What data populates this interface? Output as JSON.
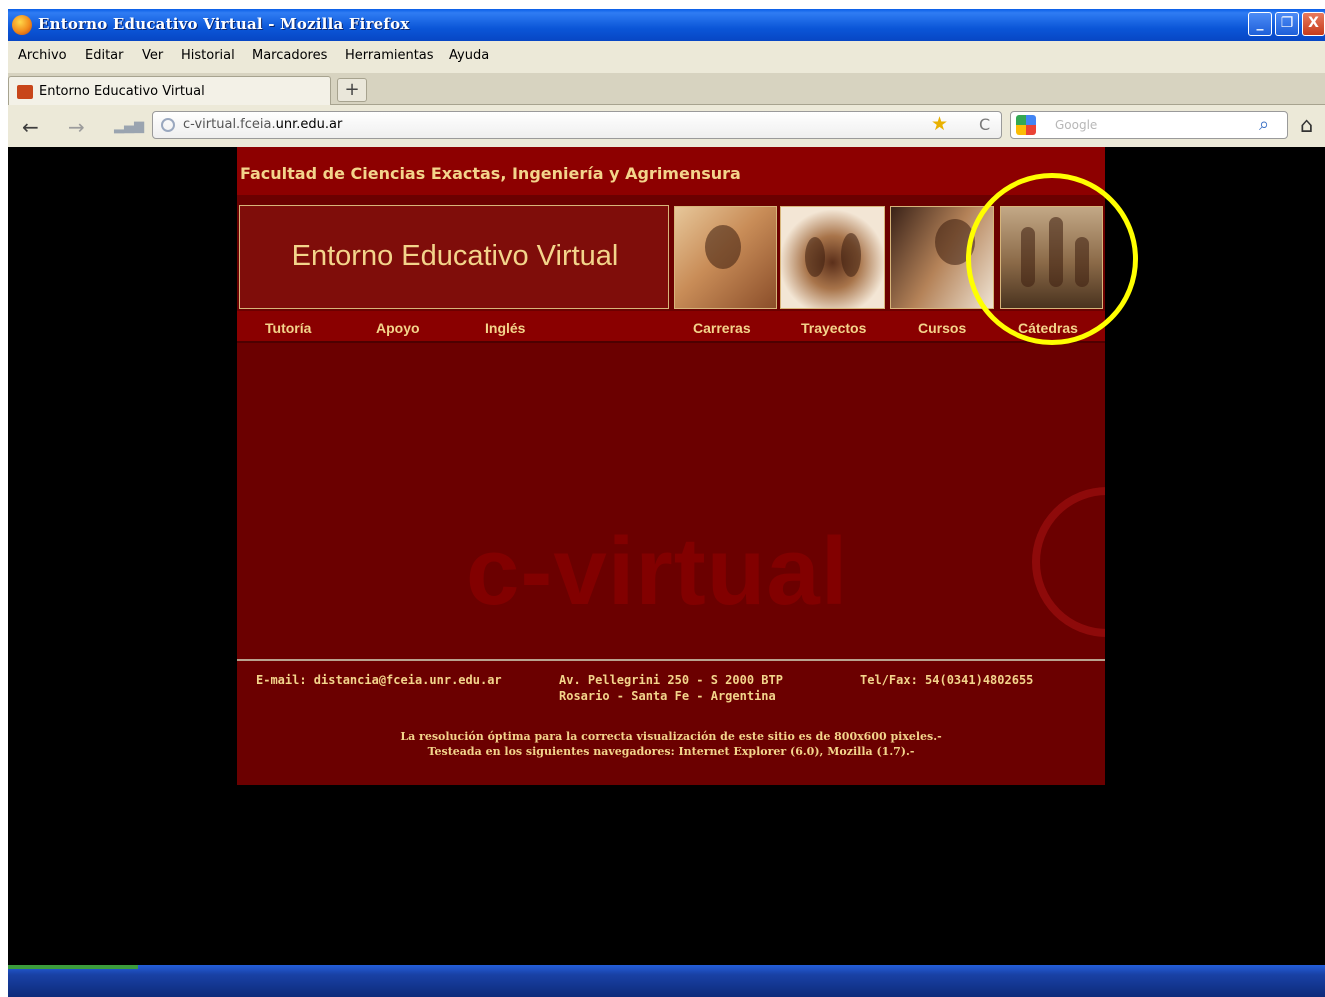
{
  "browser": {
    "window_title": "Entorno  Educativo Virtual - Mozilla Firefox",
    "menu": [
      "Archivo",
      "Editar",
      "Ver",
      "Historial",
      "Marcadores",
      "Herramientas",
      "Ayuda"
    ],
    "tab_label": "Entorno  Educativo Virtual",
    "new_tab_symbol": "+",
    "url_prefix": "c-virtual.fceia.",
    "url_domain": "unr.edu.ar",
    "search_placeholder": "Google",
    "icons": {
      "back": "←",
      "forward": "→",
      "bookmark": "★",
      "reload": "C",
      "search": "⌕",
      "home": "⌂",
      "min": "_",
      "max": "❐",
      "close": "X"
    }
  },
  "site": {
    "faculty": "Facultad de Ciencias Exactas, Ingeniería y Agrimensura",
    "banner_title": "Entorno Educativo Virtual",
    "nav": [
      "Tutoría",
      "Apoyo",
      "Inglés",
      "Carreras",
      "Trayectos",
      "Cursos",
      "Cátedras"
    ],
    "watermark": "c-virtual",
    "footer": {
      "email": "E-mail: distancia@fceia.unr.edu.ar",
      "address_line1": "Av. Pellegrini 250 - S 2000 BTP",
      "address_line2": "Rosario - Santa Fe - Argentina",
      "phone": "Tel/Fax: 54(0341)4802655",
      "note_line1": "La resolución óptima para la correcta visualización de este sitio es de 800x600 pixeles.-",
      "note_line2": "Testeada en los siguientes navegadores: Internet Explorer (6.0), Mozilla (1.7).-"
    }
  },
  "colors": {
    "site_bg": "#6b0000",
    "header_bg": "#8d0000",
    "accent_text": "#f3d48b",
    "highlight": "#ffff00"
  }
}
